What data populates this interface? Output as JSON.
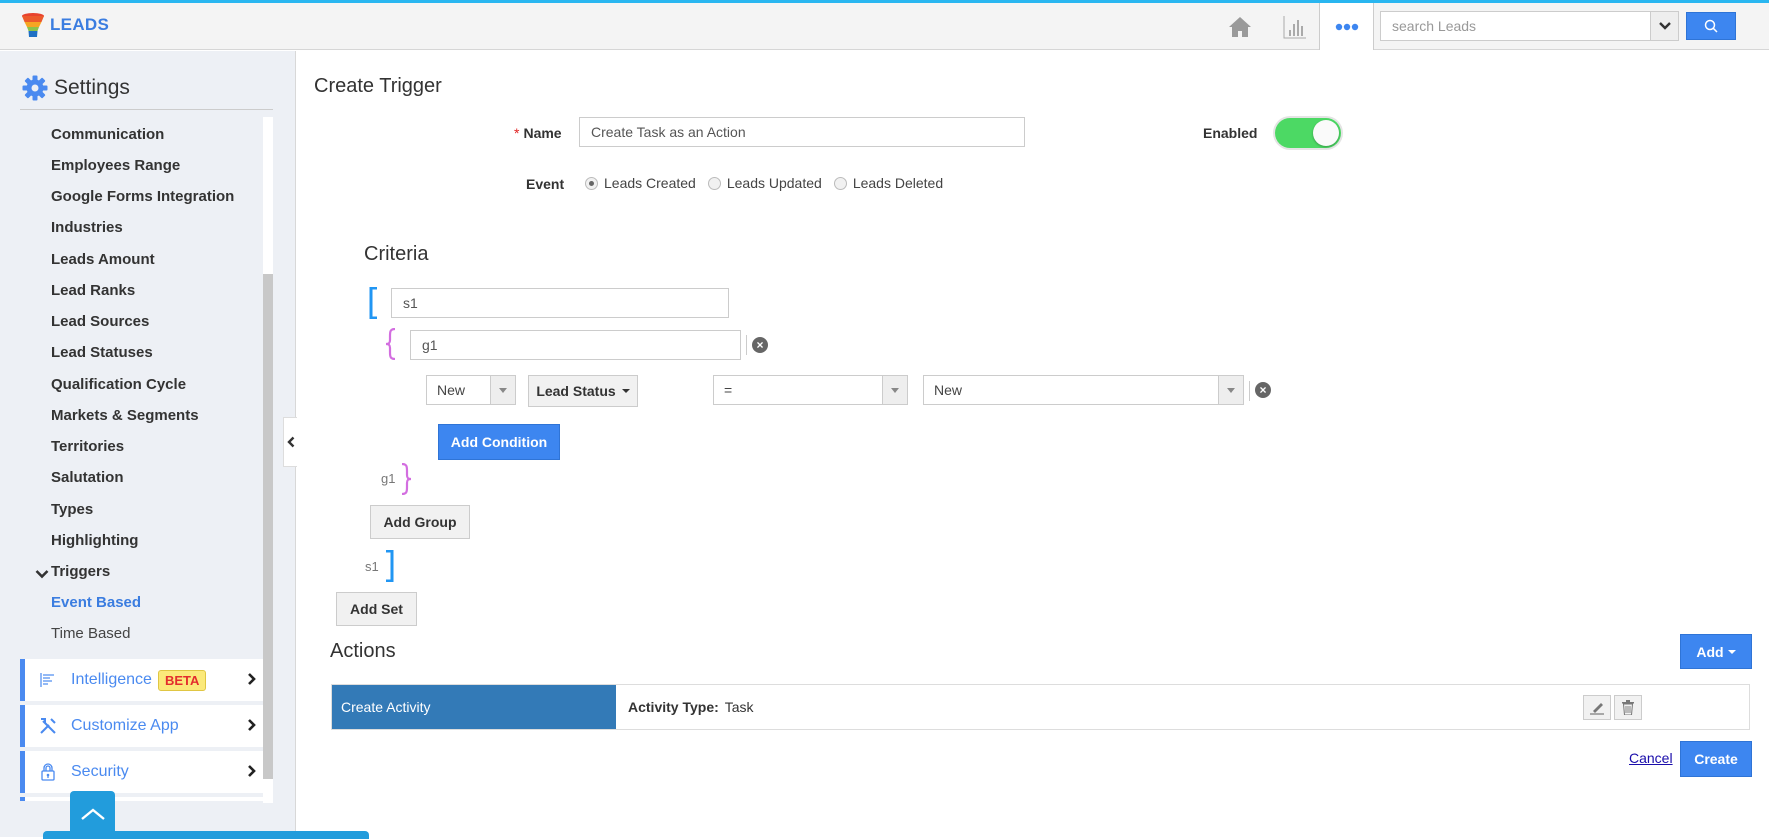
{
  "app": {
    "name": "LEADS",
    "colors": {
      "accent": "#3d86f0",
      "topline": "#29b6f0",
      "toggle_on": "#4cd964",
      "set_bracket": "#2196f3",
      "group_brace": "#d36ee0",
      "action_header": "#337ab7",
      "beta_text": "#e32d2d"
    }
  },
  "header": {
    "icons": [
      "home-icon",
      "chart-icon",
      "more-icon"
    ],
    "search": {
      "placeholder": "search Leads",
      "value": ""
    }
  },
  "sidebar": {
    "title": "Settings",
    "items": [
      {
        "label": "Communication"
      },
      {
        "label": "Employees Range"
      },
      {
        "label": "Google Forms Integration"
      },
      {
        "label": "Industries"
      },
      {
        "label": "Leads Amount"
      },
      {
        "label": "Lead Ranks"
      },
      {
        "label": "Lead Sources"
      },
      {
        "label": "Lead Statuses"
      },
      {
        "label": "Qualification Cycle"
      },
      {
        "label": "Markets & Segments"
      },
      {
        "label": "Territories"
      },
      {
        "label": "Salutation"
      },
      {
        "label": "Types"
      },
      {
        "label": "Highlighting"
      },
      {
        "label": "Triggers",
        "expanded": true
      }
    ],
    "sub_items": [
      {
        "label": "Event Based",
        "active": true
      },
      {
        "label": "Time Based",
        "active": false
      }
    ],
    "panels": [
      {
        "label": "Intelligence",
        "icon": "intelligence-icon",
        "badge": "BETA"
      },
      {
        "label": "Customize App",
        "icon": "tools-icon"
      },
      {
        "label": "Security",
        "icon": "lock-icon"
      }
    ]
  },
  "form": {
    "title": "Create Trigger",
    "name_label": "Name",
    "required_mark": "*",
    "name_value": "Create Task as an Action",
    "enabled_label": "Enabled",
    "enabled": true,
    "event_label": "Event",
    "events": [
      {
        "label": "Leads Created",
        "selected": true
      },
      {
        "label": "Leads Updated",
        "selected": false
      },
      {
        "label": "Leads Deleted",
        "selected": false
      }
    ]
  },
  "criteria": {
    "title": "Criteria",
    "set_open": "[",
    "set_close": "]",
    "group_open": "{",
    "group_close": "}",
    "set_name": "s1",
    "group_name": "g1",
    "condition": {
      "record_select": "New",
      "field_button": "Lead Status",
      "operator": "=",
      "value": "New"
    },
    "clear_symbol": "×",
    "add_condition": "Add Condition",
    "add_group": "Add Group",
    "add_set": "Add Set"
  },
  "actions": {
    "title": "Actions",
    "add_button": "Add",
    "rows": [
      {
        "name": "Create Activity",
        "detail_label": "Activity Type:",
        "detail_value": "Task"
      }
    ]
  },
  "footer": {
    "cancel": "Cancel",
    "create": "Create"
  }
}
